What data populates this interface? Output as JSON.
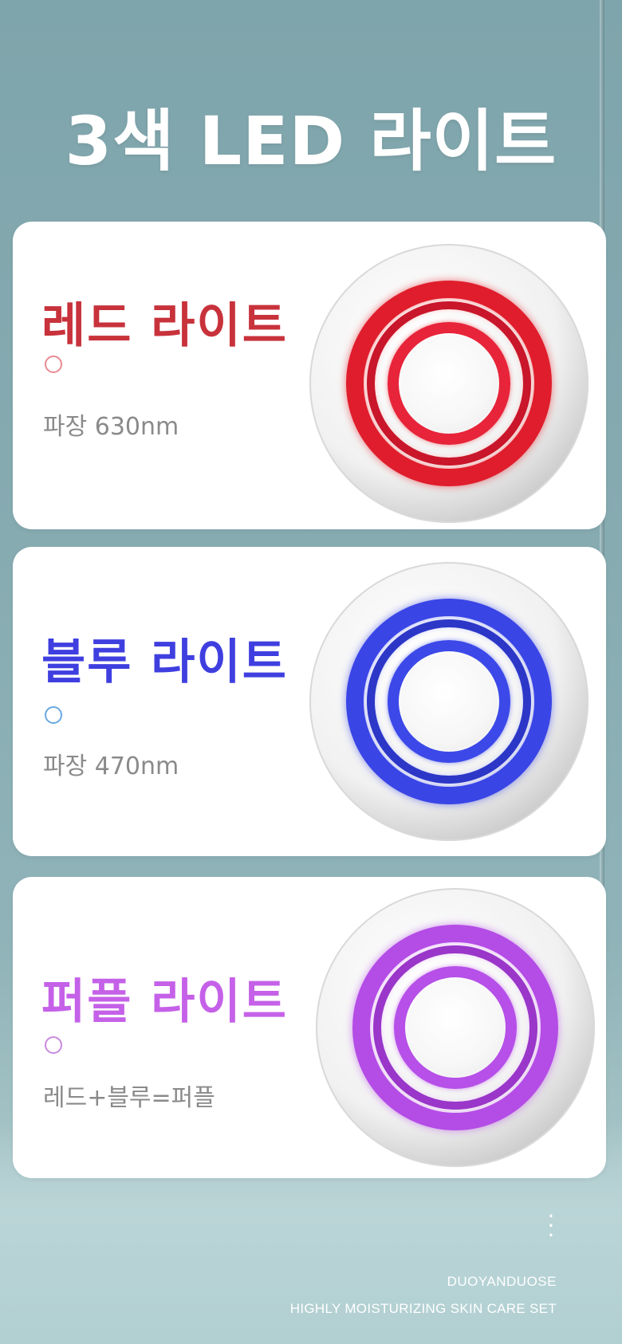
{
  "page": {
    "title": "3색 LED 라이트"
  },
  "cards": [
    {
      "title": "레드 라이트",
      "subtitle": "파장 630nm",
      "color": "#c8323b",
      "device_icon": "red-led-ring-icon"
    },
    {
      "title": "블루 라이트",
      "subtitle": "파장 470nm",
      "color": "#3f3fe0",
      "device_icon": "blue-led-ring-icon"
    },
    {
      "title": "퍼플 라이트",
      "subtitle": "레드+블루=퍼플",
      "color": "#c561e8",
      "device_icon": "purple-led-ring-icon"
    }
  ],
  "footer": {
    "more_icon": "vertical-dots-icon",
    "brand": "DUOYANDUOSE",
    "tagline": "HIGHLY MOISTURIZING SKIN CARE SET"
  }
}
